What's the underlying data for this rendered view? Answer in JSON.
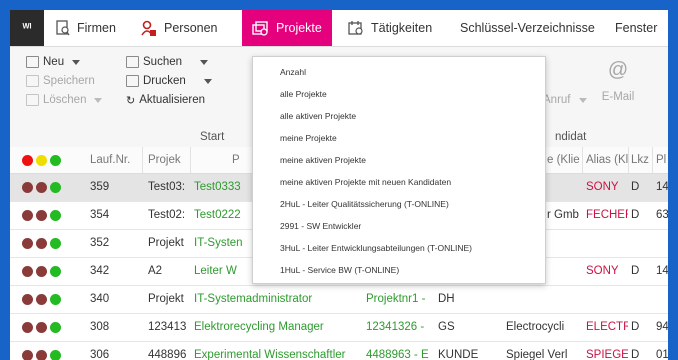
{
  "menubar": {
    "logo": "ᵂᴵ",
    "tabs": [
      {
        "label": "Firmen"
      },
      {
        "label": "Personen"
      },
      {
        "label": "Projekte"
      },
      {
        "label": "Tätigkeiten"
      },
      {
        "label": "Schlüssel-Verzeichnisse"
      },
      {
        "label": "Fenster"
      }
    ]
  },
  "ribbon": {
    "neu": "Neu",
    "speichern": "Speichern",
    "loeschen": "Löschen",
    "suchen": "Suchen",
    "drucken": "Drucken",
    "aktualisieren": "Aktualisieren",
    "anruf": "Anruf",
    "email": "E-Mail",
    "group_start": "Start",
    "group_kandidat": "ndidat"
  },
  "grid": {
    "headers": {
      "laufnr": "Lauf.Nr.",
      "projekt": "Projek",
      "p": "P",
      "klie": "e (Klie",
      "alias": "Alias (Kl",
      "lkz": "Lkz",
      "pl": "Pl"
    },
    "rows": [
      {
        "nr": "359",
        "proj": "Test03:",
        "title": "Test0333",
        "c4": "",
        "c5": "",
        "klie": "",
        "alias": "SONY",
        "lkz": "D",
        "pl": "14"
      },
      {
        "nr": "354",
        "proj": "Test02:",
        "title": "Test0222",
        "c4": "",
        "c5": "",
        "klie": "r Gmb",
        "alias": "FECHER -",
        "lkz": "D",
        "pl": "63"
      },
      {
        "nr": "352",
        "proj": "Projekt",
        "title": "IT-Systen",
        "c4": "",
        "c5": "",
        "klie": "",
        "alias": "",
        "lkz": "",
        "pl": ""
      },
      {
        "nr": "342",
        "proj": "A2",
        "title": "Leiter W",
        "c4": "",
        "c5": "",
        "klie": "",
        "alias": "SONY",
        "lkz": "D",
        "pl": "14"
      },
      {
        "nr": "340",
        "proj": "Projekt",
        "title": "IT-Systemadministrator",
        "c4": "Projektnr1 -",
        "c5": "DH",
        "klie": "",
        "alias": "",
        "lkz": "",
        "pl": ""
      },
      {
        "nr": "308",
        "proj": "123413",
        "title": "Elektrorecycling Manager",
        "c4": "12341326 -",
        "c5": "GS",
        "klie": "Electrocycli",
        "alias": "ELECTRC",
        "lkz": "D",
        "pl": "94"
      },
      {
        "nr": "306",
        "proj": "448896",
        "title": "Experimental Wissenschaftler",
        "c4": "4488963 - E",
        "c5": "KUNDE",
        "klie": "Spiegel Verl",
        "alias": "SPIEGEL",
        "lkz": "D",
        "pl": "01"
      }
    ]
  },
  "dropdown": {
    "items": [
      "Anzahl",
      "alle Projekte",
      "alle aktiven Projekte",
      "meine Projekte",
      "meine aktiven Projekte",
      "meine aktiven Projekte mit neuen Kandidaten",
      "2HuL - Leiter Qualitätssicherung (T-ONLINE)",
      "2991 - SW Entwickler",
      "3HuL - Leiter Entwicklungsabteilungen (T-ONLINE)",
      "1HuL - Service BW (T-ONLINE)"
    ]
  },
  "colors": {
    "accent": "#e5007e",
    "background": "#1763c8",
    "green_text": "#2e9b2e",
    "red_text": "#cc1144",
    "dot_brown": "#8b3a3a",
    "dot_green": "#22bb22",
    "dot_red": "#ee1111",
    "dot_yellow": "#eedd00"
  }
}
